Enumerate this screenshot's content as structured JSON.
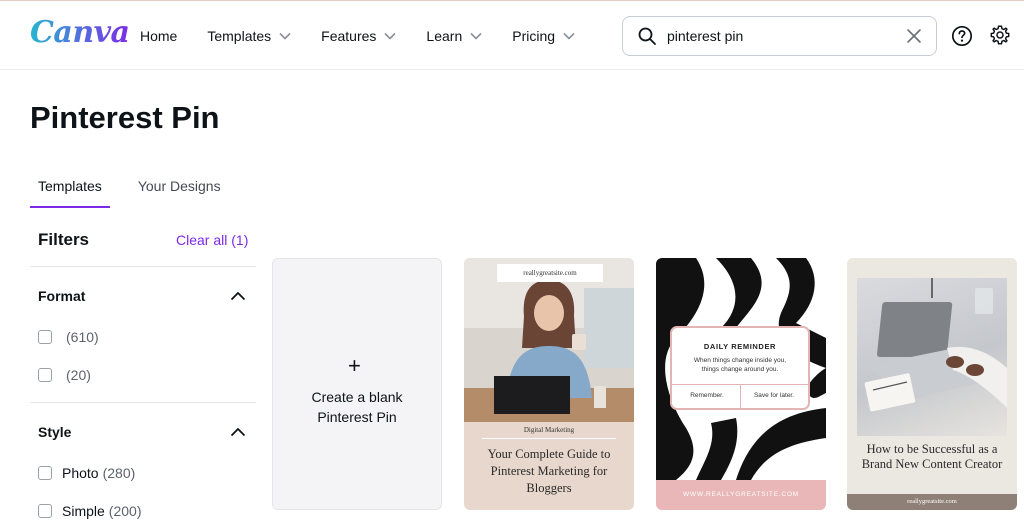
{
  "header": {
    "logo": "Canva",
    "nav": [
      "Home",
      "Templates",
      "Features",
      "Learn",
      "Pricing"
    ],
    "search_value": "pinterest pin"
  },
  "page": {
    "title": "Pinterest Pin"
  },
  "tabs": [
    "Templates",
    "Your Designs"
  ],
  "filters": {
    "title": "Filters",
    "clear_all": "Clear all (1)",
    "format": {
      "title": "Format",
      "options": [
        {
          "label": "",
          "count": "(610)"
        },
        {
          "label": "",
          "count": "(20)"
        }
      ]
    },
    "style": {
      "title": "Style",
      "options": [
        {
          "label": "Photo",
          "count": "(280)"
        },
        {
          "label": "Simple",
          "count": "(200)"
        }
      ]
    }
  },
  "cards": {
    "blank": {
      "plus": "+",
      "label_line1": "Create a blank",
      "label_line2": "Pinterest Pin"
    },
    "t1": {
      "url": "reallygreatsite.com",
      "category": "Digital Marketing",
      "title": "Your Complete Guide to Pinterest Marketing for Bloggers"
    },
    "t2": {
      "heading": "DAILY REMINDER",
      "text_line1": "When things change inside you,",
      "text_line2": "things change around you.",
      "button1": "Remember.",
      "button2": "Save for later.",
      "footer": "WWW.REALLYGREATSITE.COM"
    },
    "t3": {
      "title": "How to be Successful as a Brand New Content Creator",
      "url": "reallygreatsite.com"
    }
  },
  "colors": {
    "accent": "#7d2ae8",
    "logo_start": "#27b5d0",
    "logo_end": "#7d2ae8"
  }
}
